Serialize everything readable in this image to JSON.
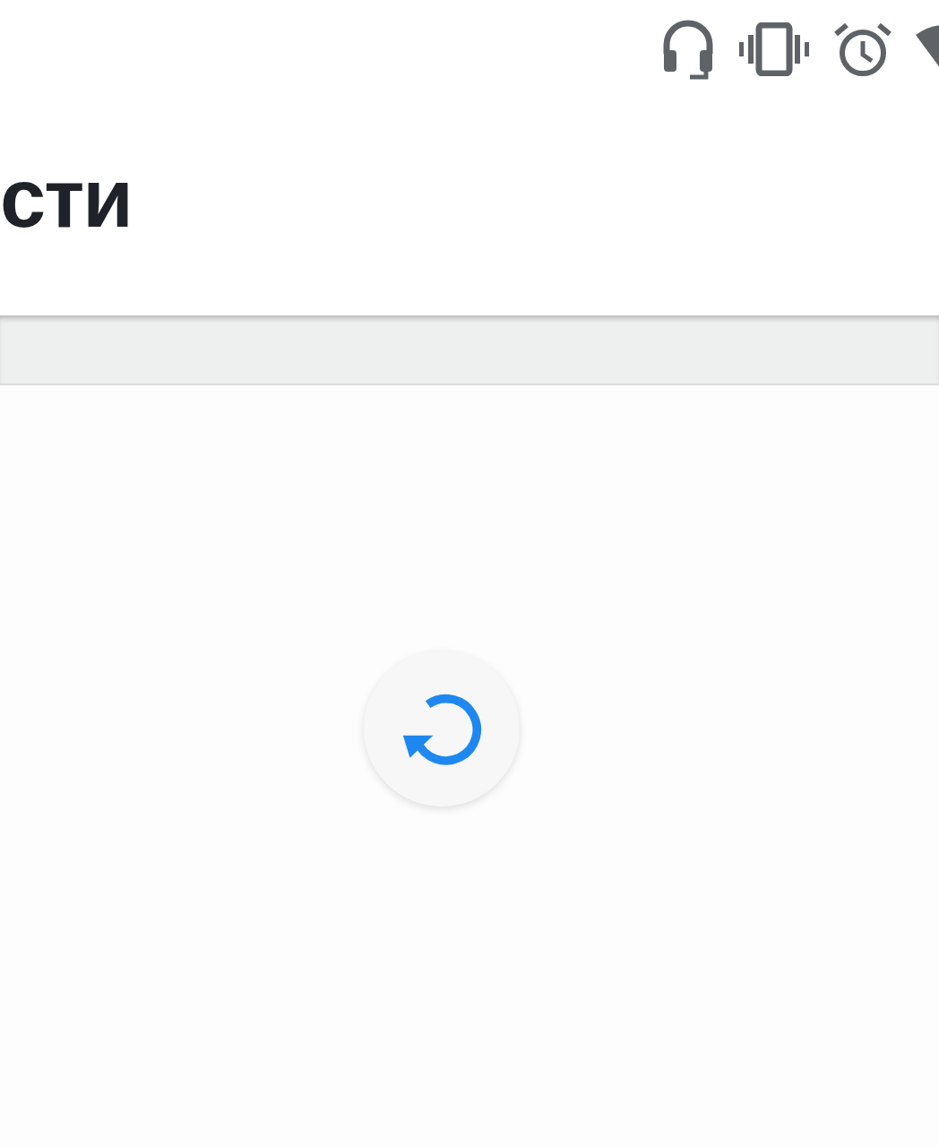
{
  "header": {
    "title": "сти"
  },
  "content": {
    "refresh_button": {
      "kind": "refresh"
    }
  }
}
